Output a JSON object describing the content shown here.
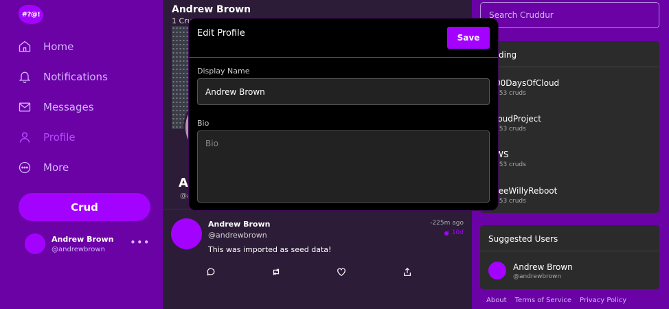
{
  "sidebar": {
    "logo": "#?@!",
    "nav": [
      {
        "label": "Home",
        "icon": "home-icon"
      },
      {
        "label": "Notifications",
        "icon": "bell-icon"
      },
      {
        "label": "Messages",
        "icon": "mail-icon"
      },
      {
        "label": "Profile",
        "icon": "user-icon",
        "active": true
      },
      {
        "label": "More",
        "icon": "more-circle-icon"
      }
    ],
    "crud_label": "Crud",
    "user": {
      "name": "Andrew Brown",
      "handle": "@andrewbrown",
      "menu": "•••"
    }
  },
  "profile": {
    "name": "Andrew Brown",
    "count_fragment": "1 Cru",
    "initial": "A",
    "handle_fragment": "@a"
  },
  "post": {
    "name": "Andrew Brown",
    "handle": "@andrewbrown",
    "time": "-225m ago",
    "expires": "10d",
    "text": "This was imported as seed data!"
  },
  "right": {
    "search_placeholder": "Search Cruddur",
    "trending_title": "ending",
    "trends": [
      {
        "name": "00DaysOfCloud",
        "count": "053 cruds"
      },
      {
        "name": "loudProject",
        "count": "253 cruds"
      },
      {
        "name": "WS",
        "count": "053 cruds"
      },
      {
        "name": "reeWillyReboot",
        "count": "753 cruds"
      }
    ],
    "suggested_title": "Suggested Users",
    "suggested": {
      "name": "Andrew Brown",
      "handle": "@andrewbrown"
    },
    "footer": [
      "About",
      "Terms of Service",
      "Privacy Policy"
    ]
  },
  "modal": {
    "title": "Edit Profile",
    "save_label": "Save",
    "display_name_label": "Display Name",
    "display_name_value": "Andrew Brown",
    "bio_label": "Bio",
    "bio_placeholder": "Bio"
  },
  "colors": {
    "accent": "#a402ff",
    "sidebar": "#6a02a6",
    "feed": "#2c1c37",
    "panel": "#2b2b2b"
  }
}
